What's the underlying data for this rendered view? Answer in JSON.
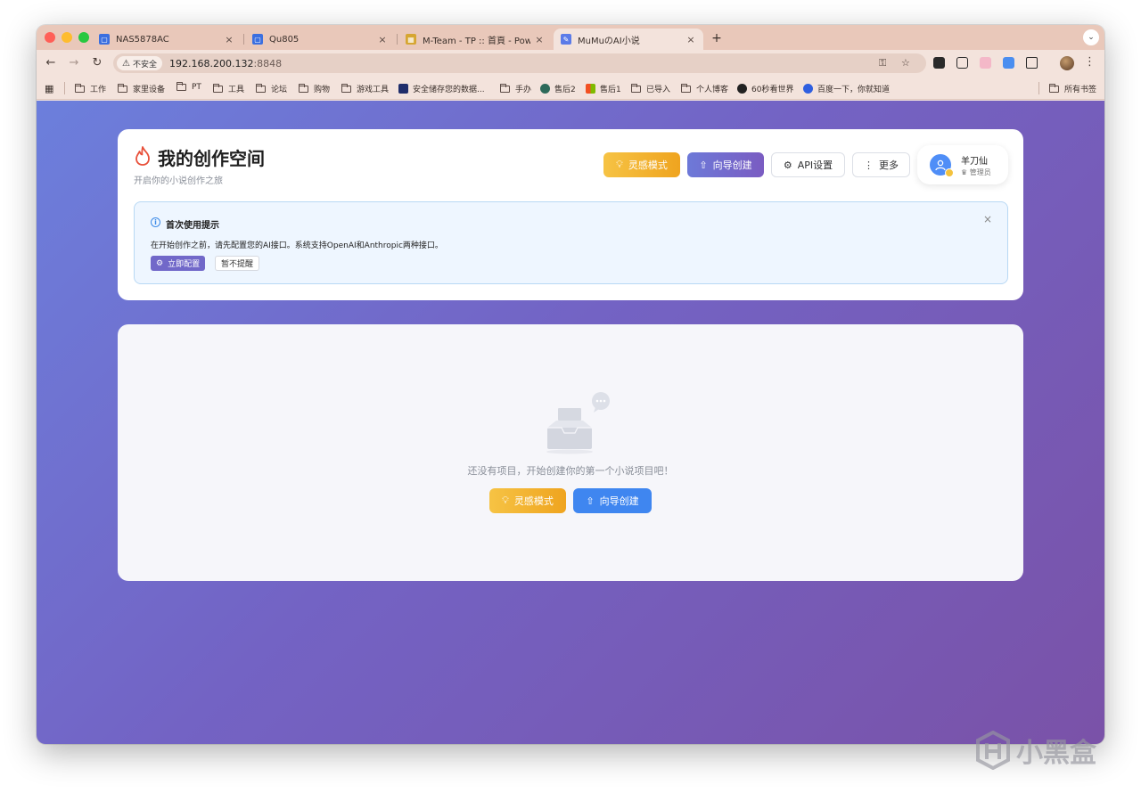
{
  "browser": {
    "tabs": [
      {
        "title": "NAS5878AC",
        "favicon_color": "#3b6fe0",
        "active": false
      },
      {
        "title": "Qu805",
        "favicon_color": "#3b6fe0",
        "active": false
      },
      {
        "title": "M-Team - TP :: 首頁 - Powere",
        "favicon_color": "#d6a632",
        "active": false
      },
      {
        "title": "MuMuのAI小说",
        "favicon_color": "#5b7be8",
        "active": true
      }
    ],
    "close_glyph": "×",
    "new_tab_glyph": "+",
    "security_label": "不安全",
    "url_host": "192.168.200.132",
    "url_port": ":8848",
    "bookmarks": [
      {
        "label": "工作",
        "type": "folder"
      },
      {
        "label": "家里设备",
        "type": "folder"
      },
      {
        "label": "PT",
        "type": "folder"
      },
      {
        "label": "工具",
        "type": "folder"
      },
      {
        "label": "论坛",
        "type": "folder"
      },
      {
        "label": "购物",
        "type": "folder"
      },
      {
        "label": "游戏工具",
        "type": "folder"
      },
      {
        "label": "安全储存您的数据...",
        "type": "site"
      },
      {
        "label": "手办",
        "type": "folder"
      },
      {
        "label": "售后2",
        "type": "site"
      },
      {
        "label": "售后1",
        "type": "site"
      },
      {
        "label": "已导入",
        "type": "folder"
      },
      {
        "label": "个人博客",
        "type": "folder"
      },
      {
        "label": "60秒看世界",
        "type": "site"
      },
      {
        "label": "百度一下，你就知道",
        "type": "site"
      }
    ],
    "all_bookmarks_label": "所有书签"
  },
  "header": {
    "title": "我的创作空间",
    "subtitle": "开启你的小说创作之旅",
    "buttons": {
      "inspire": "灵感模式",
      "wizard": "向导创建",
      "api": "API设置",
      "more": "更多"
    },
    "user": {
      "name": "羊刀仙",
      "role": "管理员"
    }
  },
  "tip": {
    "title": "首次使用提示",
    "body": "在开始创作之前，请先配置您的AI接口。系统支持OpenAI和Anthropic两种接口。",
    "config_button": "立即配置",
    "later_button": "暂不提醒",
    "close_glyph": "×"
  },
  "empty_state": {
    "message": "还没有项目，开始创建你的第一个小说项目吧！",
    "inspire_button": "灵感模式",
    "wizard_button": "向导创建"
  },
  "watermark": {
    "text": "小黑盒"
  },
  "colors": {
    "accent_purple": "#7168c9",
    "inspire_orange": "#efa41f",
    "wizard_blue": "#3f86f0",
    "info_blue": "#3d8be8"
  }
}
